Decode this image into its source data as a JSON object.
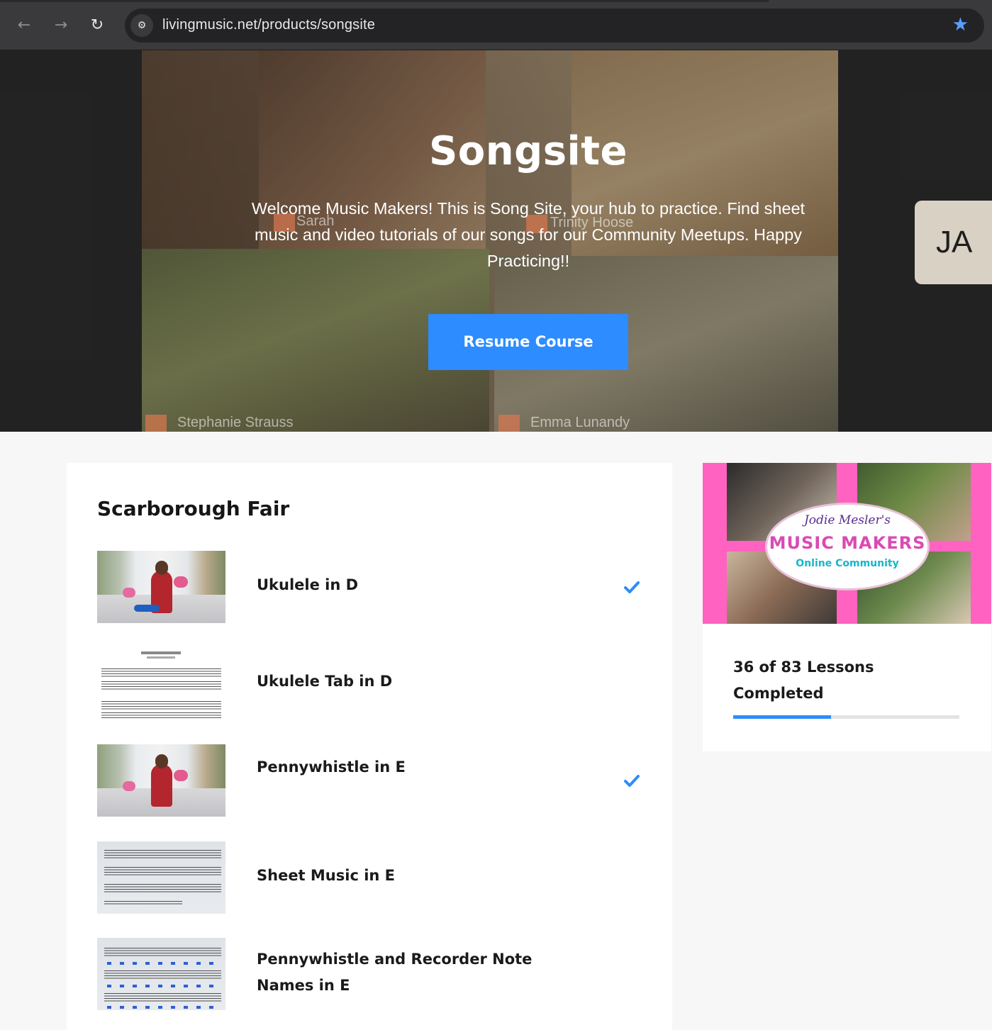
{
  "browser": {
    "url": "livingmusic.net/products/songsite",
    "back_icon": "←",
    "forward_icon": "→",
    "reload_icon": "↻",
    "site_info_icon": "⚙",
    "bookmark_icon": "★"
  },
  "hero": {
    "title": "Songsite",
    "description": "Welcome Music Makers! This is Song Site, your hub to practice. Find sheet music and video tutorials of our songs for our Community Meetups. Happy Practicing!!",
    "resume_label": "Resume Course",
    "side_tile_initials": "JA",
    "video_names": [
      "Sarah",
      "Trinity Hoose",
      "Stephanie Strauss",
      "Emma Lunandy"
    ]
  },
  "section": {
    "title": "Scarborough Fair",
    "lessons": [
      {
        "title": "Ukulele in D",
        "completed": true
      },
      {
        "title": "Ukulele Tab in D",
        "completed": false
      },
      {
        "title": "Pennywhistle in E",
        "completed": true
      },
      {
        "title": "Sheet Music in E",
        "completed": false
      },
      {
        "title": "Pennywhistle and Recorder Note Names in E",
        "completed": false
      }
    ]
  },
  "sidebar": {
    "promo": {
      "script_text": "Jodie Mesler's",
      "brand": "MUSIC MAKERS",
      "tagline": "Online Community"
    },
    "progress": {
      "text": "36 of 83 Lessons Completed",
      "completed": 36,
      "total": 83
    }
  },
  "colors": {
    "accent": "#2d8cff",
    "promo_pink": "#ff62c0"
  }
}
